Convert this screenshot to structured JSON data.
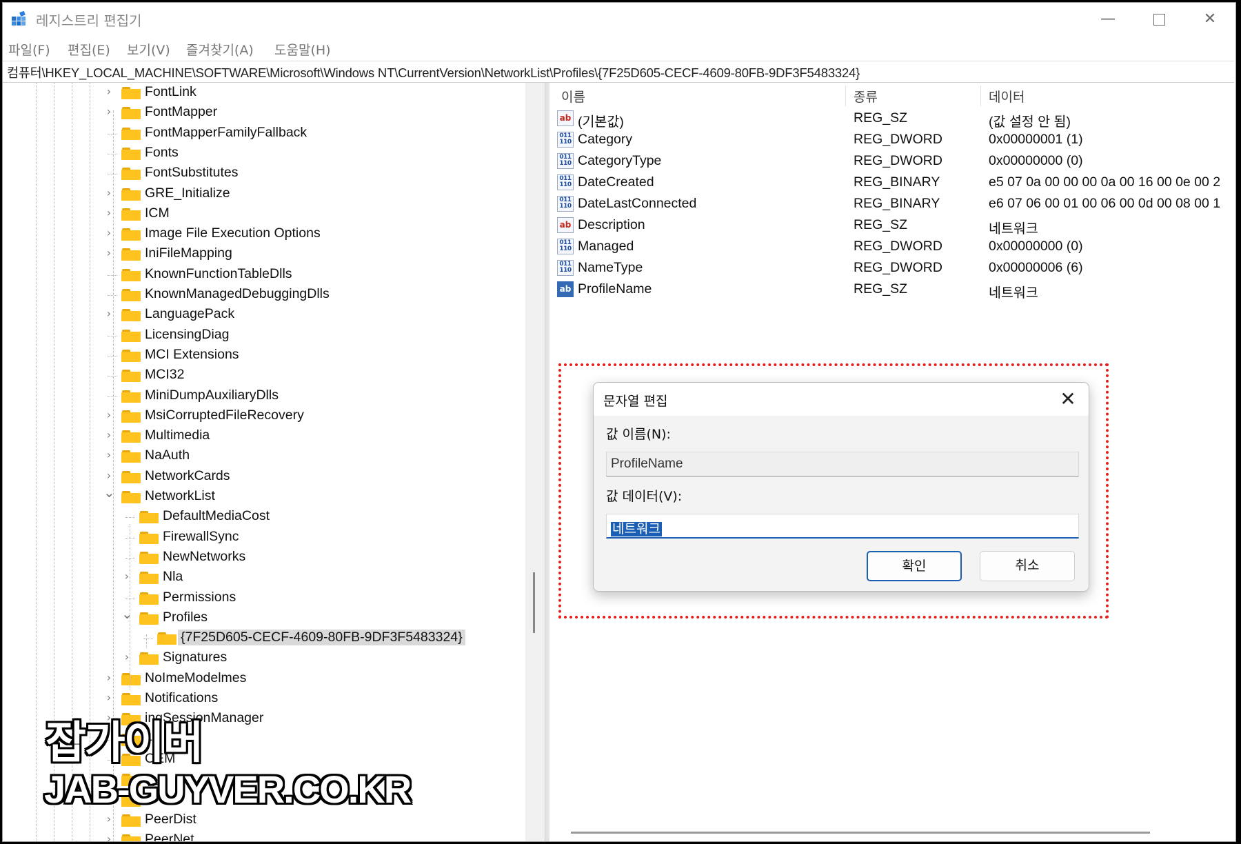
{
  "window": {
    "title": "레지스트리 편집기"
  },
  "menu": [
    "파일(F)",
    "편집(E)",
    "보기(V)",
    "즐겨찾기(A)",
    "도움말(H)"
  ],
  "address": "컴퓨터\\HKEY_LOCAL_MACHINE\\SOFTWARE\\Microsoft\\Windows NT\\CurrentVersion\\NetworkList\\Profiles\\{7F25D605-CECF-4609-80FB-9DF3F5483324}",
  "tree": [
    {
      "label": "FontLink",
      "level": 0,
      "expander": "collapsed"
    },
    {
      "label": "FontMapper",
      "level": 0,
      "expander": "collapsed"
    },
    {
      "label": "FontMapperFamilyFallback",
      "level": 0,
      "expander": "none"
    },
    {
      "label": "Fonts",
      "level": 0,
      "expander": "none"
    },
    {
      "label": "FontSubstitutes",
      "level": 0,
      "expander": "none"
    },
    {
      "label": "GRE_Initialize",
      "level": 0,
      "expander": "collapsed"
    },
    {
      "label": "ICM",
      "level": 0,
      "expander": "collapsed"
    },
    {
      "label": "Image File Execution Options",
      "level": 0,
      "expander": "collapsed"
    },
    {
      "label": "IniFileMapping",
      "level": 0,
      "expander": "collapsed"
    },
    {
      "label": "KnownFunctionTableDlls",
      "level": 0,
      "expander": "none"
    },
    {
      "label": "KnownManagedDebuggingDlls",
      "level": 0,
      "expander": "none"
    },
    {
      "label": "LanguagePack",
      "level": 0,
      "expander": "collapsed"
    },
    {
      "label": "LicensingDiag",
      "level": 0,
      "expander": "none"
    },
    {
      "label": "MCI Extensions",
      "level": 0,
      "expander": "none"
    },
    {
      "label": "MCI32",
      "level": 0,
      "expander": "none"
    },
    {
      "label": "MiniDumpAuxiliaryDlls",
      "level": 0,
      "expander": "none"
    },
    {
      "label": "MsiCorruptedFileRecovery",
      "level": 0,
      "expander": "collapsed"
    },
    {
      "label": "Multimedia",
      "level": 0,
      "expander": "collapsed"
    },
    {
      "label": "NaAuth",
      "level": 0,
      "expander": "collapsed"
    },
    {
      "label": "NetworkCards",
      "level": 0,
      "expander": "collapsed"
    },
    {
      "label": "NetworkList",
      "level": 0,
      "expander": "expanded"
    },
    {
      "label": "DefaultMediaCost",
      "level": 1,
      "expander": "none"
    },
    {
      "label": "FirewallSync",
      "level": 1,
      "expander": "none"
    },
    {
      "label": "NewNetworks",
      "level": 1,
      "expander": "none"
    },
    {
      "label": "Nla",
      "level": 1,
      "expander": "collapsed"
    },
    {
      "label": "Permissions",
      "level": 1,
      "expander": "none"
    },
    {
      "label": "Profiles",
      "level": 1,
      "expander": "expanded"
    },
    {
      "label": "{7F25D605-CECF-4609-80FB-9DF3F5483324}",
      "level": 2,
      "expander": "none",
      "selected": true
    },
    {
      "label": "Signatures",
      "level": 1,
      "expander": "collapsed"
    },
    {
      "label": "NoImeModelmes",
      "level": 0,
      "expander": "collapsed"
    },
    {
      "label": "Notifications",
      "level": 0,
      "expander": "collapsed"
    },
    {
      "label": "ingSessionManager",
      "level": 0,
      "expander": "collapsed"
    },
    {
      "label": "4",
      "level": 0,
      "expander": "none"
    },
    {
      "label": "OEM",
      "level": 0,
      "expander": "none"
    },
    {
      "label": "",
      "level": 0,
      "expander": "collapsed"
    },
    {
      "label": "s",
      "level": 0,
      "expander": "collapsed"
    },
    {
      "label": "PeerDist",
      "level": 0,
      "expander": "collapsed"
    },
    {
      "label": "PeerNet",
      "level": 0,
      "expander": "collapsed"
    }
  ],
  "list": {
    "headers": {
      "name": "이름",
      "type": "종류",
      "data": "데이터"
    },
    "rows": [
      {
        "icon": "string",
        "name": "(기본값)",
        "type": "REG_SZ",
        "data": "(값 설정 안 됨)"
      },
      {
        "icon": "binary",
        "name": "Category",
        "type": "REG_DWORD",
        "data": "0x00000001 (1)"
      },
      {
        "icon": "binary",
        "name": "CategoryType",
        "type": "REG_DWORD",
        "data": "0x00000000 (0)"
      },
      {
        "icon": "binary",
        "name": "DateCreated",
        "type": "REG_BINARY",
        "data": "e5 07 0a 00 00 00 0a 00 16 00 0e 00 2"
      },
      {
        "icon": "binary",
        "name": "DateLastConnected",
        "type": "REG_BINARY",
        "data": "e6 07 06 00 01 00 06 00 0d 00 08 00 1"
      },
      {
        "icon": "string",
        "name": "Description",
        "type": "REG_SZ",
        "data": "네트워크"
      },
      {
        "icon": "binary",
        "name": "Managed",
        "type": "REG_DWORD",
        "data": "0x00000000 (0)"
      },
      {
        "icon": "binary",
        "name": "NameType",
        "type": "REG_DWORD",
        "data": "0x00000006 (6)"
      },
      {
        "icon": "string-selected",
        "name": "ProfileName",
        "type": "REG_SZ",
        "data": "네트워크"
      }
    ]
  },
  "dialog": {
    "title": "문자열 편집",
    "name_label": "값 이름(N):",
    "name_value": "ProfileName",
    "data_label": "값 데이터(V):",
    "data_value": "네트워크",
    "ok_label": "확인",
    "cancel_label": "취소"
  },
  "icons": {
    "string": "ab",
    "binary_top": "011",
    "binary_bottom": "110"
  },
  "colors": {
    "folder": "#ffc31f",
    "accent": "#1a5fb4",
    "highlight_box": "#e61e1e"
  },
  "watermark": {
    "korean": "잡가이버",
    "url": "JAB-GUYVER.CO.KR"
  }
}
